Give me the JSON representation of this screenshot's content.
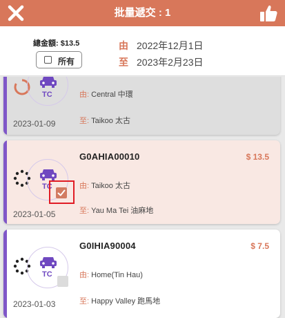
{
  "topbar": {
    "title": "批量遞交 : 1",
    "close_icon": "close-icon",
    "submit_icon": "thumbs-up-icon",
    "color": "#d8775a"
  },
  "summary": {
    "total_label": "總金額: $13.5",
    "select_all_label": "所有",
    "from_key": "由",
    "from_value": "2022年12月1日",
    "to_key": "至",
    "to_value": "2023年2月23日"
  },
  "records": [
    {
      "ref": "",
      "amount": "",
      "from_key": "由:",
      "from_value": "Central 中環",
      "to_key": "至:",
      "to_value": "Taikoo 太古",
      "date": "2023-01-09",
      "badge": "TC",
      "status_icon": "progress-ring-icon",
      "selected": false
    },
    {
      "ref": "G0AHIA00010",
      "amount": "$ 13.5",
      "from_key": "由:",
      "from_value": "Taikoo 太古",
      "to_key": "至:",
      "to_value": "Yau Ma Tei 油麻地",
      "date": "2023-01-05",
      "badge": "TC",
      "status_icon": "loading-spinner-icon",
      "selected": true
    },
    {
      "ref": "G0IHIA90004",
      "amount": "$ 7.5",
      "from_key": "由:",
      "from_value": "Home(Tin Hau)",
      "to_key": "至:",
      "to_value": "Happy Valley 跑馬地",
      "date": "2023-01-03",
      "badge": "TC",
      "status_icon": "loading-spinner-icon",
      "selected": false
    }
  ],
  "colors": {
    "accent": "#d8775a",
    "stripe": "#7f57c8",
    "selected_card": "#f9e8e3",
    "inactive_card": "#dedede",
    "highlight": "#e01b24"
  }
}
